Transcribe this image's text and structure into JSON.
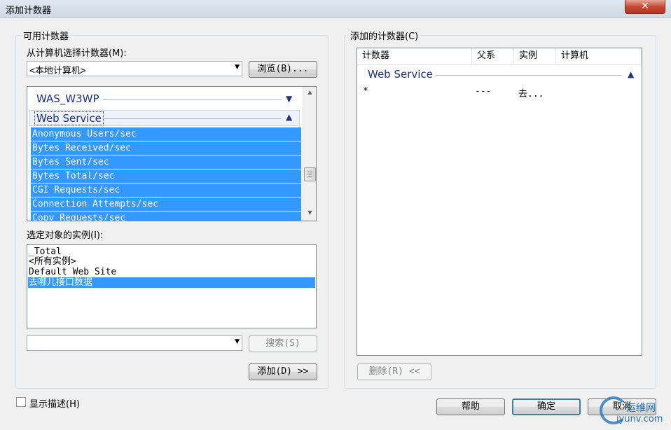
{
  "window": {
    "title": "添加计数器",
    "close_glyph": "✕"
  },
  "available": {
    "group_label": "可用计数器",
    "select_from_label": "从计算机选择计数器(M):",
    "computer_combo_value": "<本地计算机>",
    "browse_button": "浏览(B)...",
    "categories": [
      {
        "name": "WAS_W3WP",
        "expanded": false
      },
      {
        "name": "Web Service",
        "expanded": true
      }
    ],
    "counters": [
      "Anonymous Users/sec",
      "Bytes Received/sec",
      "Bytes Sent/sec",
      "Bytes Total/sec",
      "CGI Requests/sec",
      "Connection Attempts/sec",
      "Copy Requests/sec"
    ],
    "instances_label": "选定对象的实例(I):",
    "instances": [
      "_Total",
      "<所有实例>",
      "Default Web Site",
      "去哪儿接口数据"
    ],
    "selected_instance": "去哪儿接口数据",
    "search_combo_value": "",
    "search_button": "搜索(S)",
    "add_button": "添加(D) >>"
  },
  "added": {
    "group_label": "添加的计数器(C)",
    "columns": [
      "计数器",
      "父系",
      "实例",
      "计算机"
    ],
    "group_name": "Web Service",
    "rows": [
      {
        "counter": "*",
        "parent": "---",
        "instance": "去...",
        "computer": ""
      }
    ],
    "remove_button": "删除(R) <<"
  },
  "show_description": {
    "label": "显示描述(H)",
    "checked": false
  },
  "footer": {
    "help": "帮助",
    "ok": "确定",
    "cancel": "取消"
  },
  "watermark": {
    "line1": "运维网",
    "line2": "iyunv.com"
  }
}
